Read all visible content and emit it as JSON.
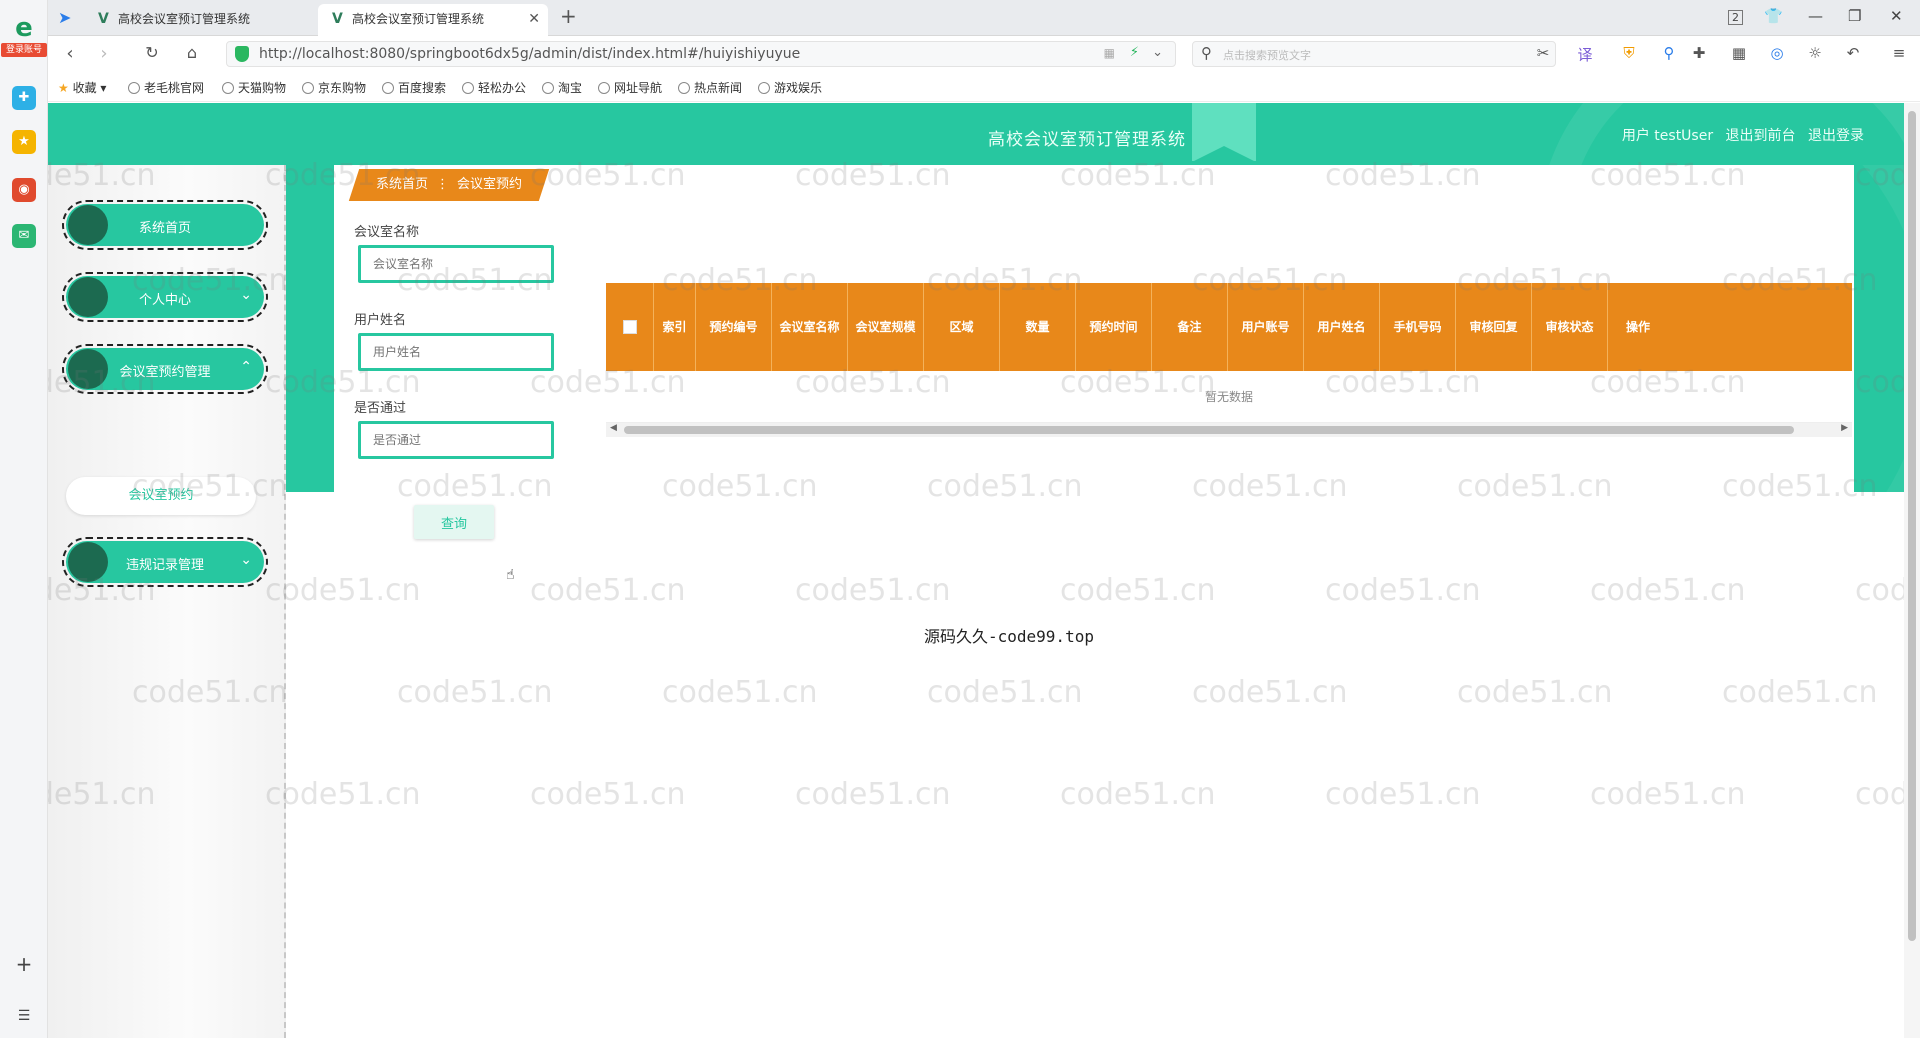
{
  "browser": {
    "rail_badge": "登录账号",
    "tabs": [
      {
        "label": "高校会议室预订管理系统"
      },
      {
        "label": "高校会议室预订管理系统"
      }
    ],
    "tab_badge_count": "2",
    "url": "http://localhost:8080/springboot6dx5g/admin/dist/index.html#/huiyishiyuyue",
    "search_placeholder": "点击搜索预览文字",
    "bookmarks": [
      "收藏",
      "老毛桃官网",
      "天猫购物",
      "京东购物",
      "百度搜索",
      "轻松办公",
      "淘宝",
      "网址导航",
      "热点新闻",
      "游戏娱乐"
    ]
  },
  "header": {
    "title": "高校会议室预订管理系统",
    "user_label": "用户 testUser",
    "back_to_front": "退出到前台",
    "logout": "退出登录"
  },
  "sidebar": {
    "items": [
      {
        "label": "系统首页",
        "chevron": ""
      },
      {
        "label": "个人中心",
        "chevron": "⌄"
      },
      {
        "label": "会议室预约管理",
        "chevron": "⌃"
      },
      {
        "label": "违规记录管理",
        "chevron": "⌄"
      }
    ],
    "submenu": {
      "label": "会议室预约"
    }
  },
  "breadcrumb": {
    "home": "系统首页",
    "separator": "⋮",
    "current": "会议室预约"
  },
  "search_form": {
    "fields": [
      {
        "label": "会议室名称",
        "placeholder": "会议室名称"
      },
      {
        "label": "用户姓名",
        "placeholder": "用户姓名"
      },
      {
        "label": "是否通过",
        "placeholder": "是否通过"
      }
    ],
    "query_button": "查询"
  },
  "table": {
    "columns": [
      "索引",
      "预约编号",
      "会议室名称",
      "会议室规模",
      "区域",
      "数量",
      "预约时间",
      "备注",
      "用户账号",
      "用户姓名",
      "手机号码",
      "审核回复",
      "审核状态",
      "操作"
    ],
    "empty_text": "暂无数据"
  },
  "footer_text": "源码久久-code99.top",
  "watermark": "code51.cn",
  "colors": {
    "primary": "#27c7a0",
    "accent": "#e8881a",
    "dark": "#1c6a50"
  }
}
